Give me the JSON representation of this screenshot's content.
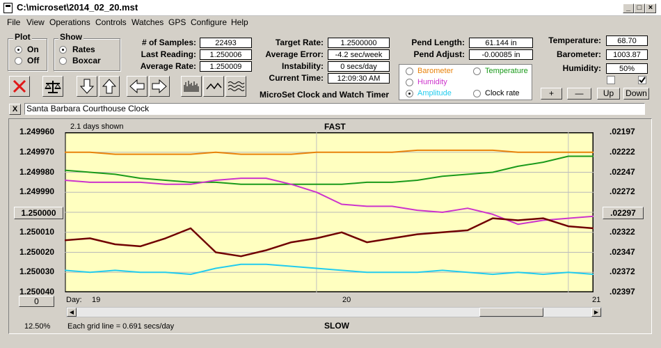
{
  "window": {
    "title": "C:\\microset\\2014_02_20.mst",
    "buttons": [
      "_",
      "□",
      "×"
    ]
  },
  "menu": [
    "File",
    "View",
    "Operations",
    "Controls",
    "Watches",
    "GPS",
    "Configure",
    "Help"
  ],
  "plot_group": {
    "label": "Plot",
    "options": [
      "On",
      "Off"
    ],
    "selected": "On"
  },
  "show_group": {
    "label": "Show",
    "options": [
      "Rates",
      "Boxcar"
    ],
    "selected": "Rates"
  },
  "stats": [
    {
      "label": "# of Samples:",
      "value": "22493"
    },
    {
      "label": "Last Reading:",
      "value": "1.250006"
    },
    {
      "label": "Average Rate:",
      "value": "1.250009"
    }
  ],
  "targets": [
    {
      "label": "Target Rate:",
      "value": "1.2500000"
    },
    {
      "label": "Average Error:",
      "value": "-4.2 sec/week"
    },
    {
      "label": "Instability:",
      "value": "0 secs/day"
    },
    {
      "label": "Current Time:",
      "value": "12:09:30 AM"
    }
  ],
  "pendulum": [
    {
      "label": "Pend Length:",
      "value": "61.144 in"
    },
    {
      "label": "Pend Adjust:",
      "value": "-0.00085 in"
    }
  ],
  "environment": [
    {
      "label": "Temperature:",
      "value": "68.70"
    },
    {
      "label": "Barometer:",
      "value": "1003.87"
    },
    {
      "label": "Humidity:",
      "value": "50%"
    }
  ],
  "series_options": [
    {
      "label": "Barometer",
      "color": "#e8820a",
      "selected": false
    },
    {
      "label": "Temperature",
      "color": "#1a9a1a",
      "selected": false
    },
    {
      "label": "Humidity",
      "color": "#cc33cc",
      "selected": false
    },
    {
      "label": "Clock rate",
      "color": "#000000",
      "selected": false
    },
    {
      "label": "Amplitude",
      "color": "#22ccee",
      "selected": true
    }
  ],
  "app_caption": "MicroSet Clock and Watch Timer",
  "toolbar_icons": [
    "close-icon",
    "balance-scale-icon",
    "arrow-down-icon",
    "arrow-up-icon",
    "arrow-left-icon",
    "arrow-right-icon",
    "bar-chart-icon",
    "line-wave-icon",
    "multi-wave-icon"
  ],
  "nav_buttons": [
    "+",
    "—",
    "Up",
    "Down"
  ],
  "checkboxes": [
    {
      "checked": false
    },
    {
      "checked": true
    }
  ],
  "clear_button": "X",
  "clock_name": "Santa Barbara Courthouse Clock",
  "plot": {
    "days_shown": "2.1 days shown",
    "top_label": "FAST",
    "bottom_label": "SLOW",
    "grid_note": "Each grid line = 0.691 secs/day",
    "zoom": "12.50%",
    "left_button": "1.250000",
    "right_button": ".02297",
    "reset_button": "0",
    "day_label": "Day:",
    "day_ticks": [
      "19",
      "20",
      "21"
    ]
  },
  "chart_data": {
    "type": "line",
    "left_axis_ticks": [
      "1.249960",
      "1.249970",
      "1.249980",
      "1.249990",
      "1.250000",
      "1.250010",
      "1.250020",
      "1.250030",
      "1.250040"
    ],
    "right_axis_ticks": [
      ".02197",
      ".02222",
      ".02247",
      ".02272",
      ".02297",
      ".02322",
      ".02347",
      ".02372",
      ".02397"
    ],
    "ylim": [
      1.24996,
      1.25004
    ],
    "x_range_days": [
      19,
      21.1
    ],
    "inverted_y": true,
    "plot_background": "#ffffc0",
    "x_positions": [
      19.0,
      19.1,
      19.2,
      19.3,
      19.4,
      19.5,
      19.6,
      19.7,
      19.8,
      19.9,
      20.0,
      20.1,
      20.2,
      20.3,
      20.4,
      20.5,
      20.6,
      20.7,
      20.8,
      20.9,
      21.0,
      21.1
    ],
    "series": [
      {
        "name": "Barometer",
        "color": "#e8820a",
        "values": [
          1.24997,
          1.24997,
          1.249971,
          1.249971,
          1.249971,
          1.249971,
          1.24997,
          1.249971,
          1.249971,
          1.249971,
          1.24997,
          1.24997,
          1.24997,
          1.24997,
          1.249969,
          1.249969,
          1.249969,
          1.249969,
          1.24997,
          1.24997,
          1.24997,
          1.24997
        ]
      },
      {
        "name": "Temperature",
        "color": "#1a9a1a",
        "values": [
          1.249979,
          1.24998,
          1.249981,
          1.249983,
          1.249984,
          1.249985,
          1.249985,
          1.249986,
          1.249986,
          1.249986,
          1.249986,
          1.249986,
          1.249985,
          1.249985,
          1.249984,
          1.249982,
          1.249981,
          1.24998,
          1.249977,
          1.249975,
          1.249972,
          1.249972
        ]
      },
      {
        "name": "Humidity",
        "color": "#cc33cc",
        "values": [
          1.249984,
          1.249985,
          1.249985,
          1.249985,
          1.249986,
          1.249986,
          1.249984,
          1.249983,
          1.249983,
          1.249986,
          1.24999,
          1.249996,
          1.249997,
          1.249997,
          1.249999,
          1.25,
          1.249998,
          1.250001,
          1.250006,
          1.250004,
          1.250003,
          1.250002
        ]
      },
      {
        "name": "Amplitude",
        "color": "#22ccee",
        "values": [
          1.250029,
          1.25003,
          1.250029,
          1.25003,
          1.25003,
          1.250031,
          1.250028,
          1.250026,
          1.250026,
          1.250027,
          1.250028,
          1.250029,
          1.25003,
          1.25003,
          1.25003,
          1.250029,
          1.25003,
          1.250031,
          1.25003,
          1.250031,
          1.25003,
          1.250031
        ]
      },
      {
        "name": "Clock rate",
        "color": "#700000",
        "values": [
          1.250014,
          1.250013,
          1.250016,
          1.250017,
          1.250013,
          1.250008,
          1.25002,
          1.250022,
          1.250019,
          1.250015,
          1.250013,
          1.25001,
          1.250015,
          1.250013,
          1.250011,
          1.25001,
          1.250009,
          1.250003,
          1.250004,
          1.250003,
          1.250007,
          1.250008
        ]
      }
    ]
  }
}
